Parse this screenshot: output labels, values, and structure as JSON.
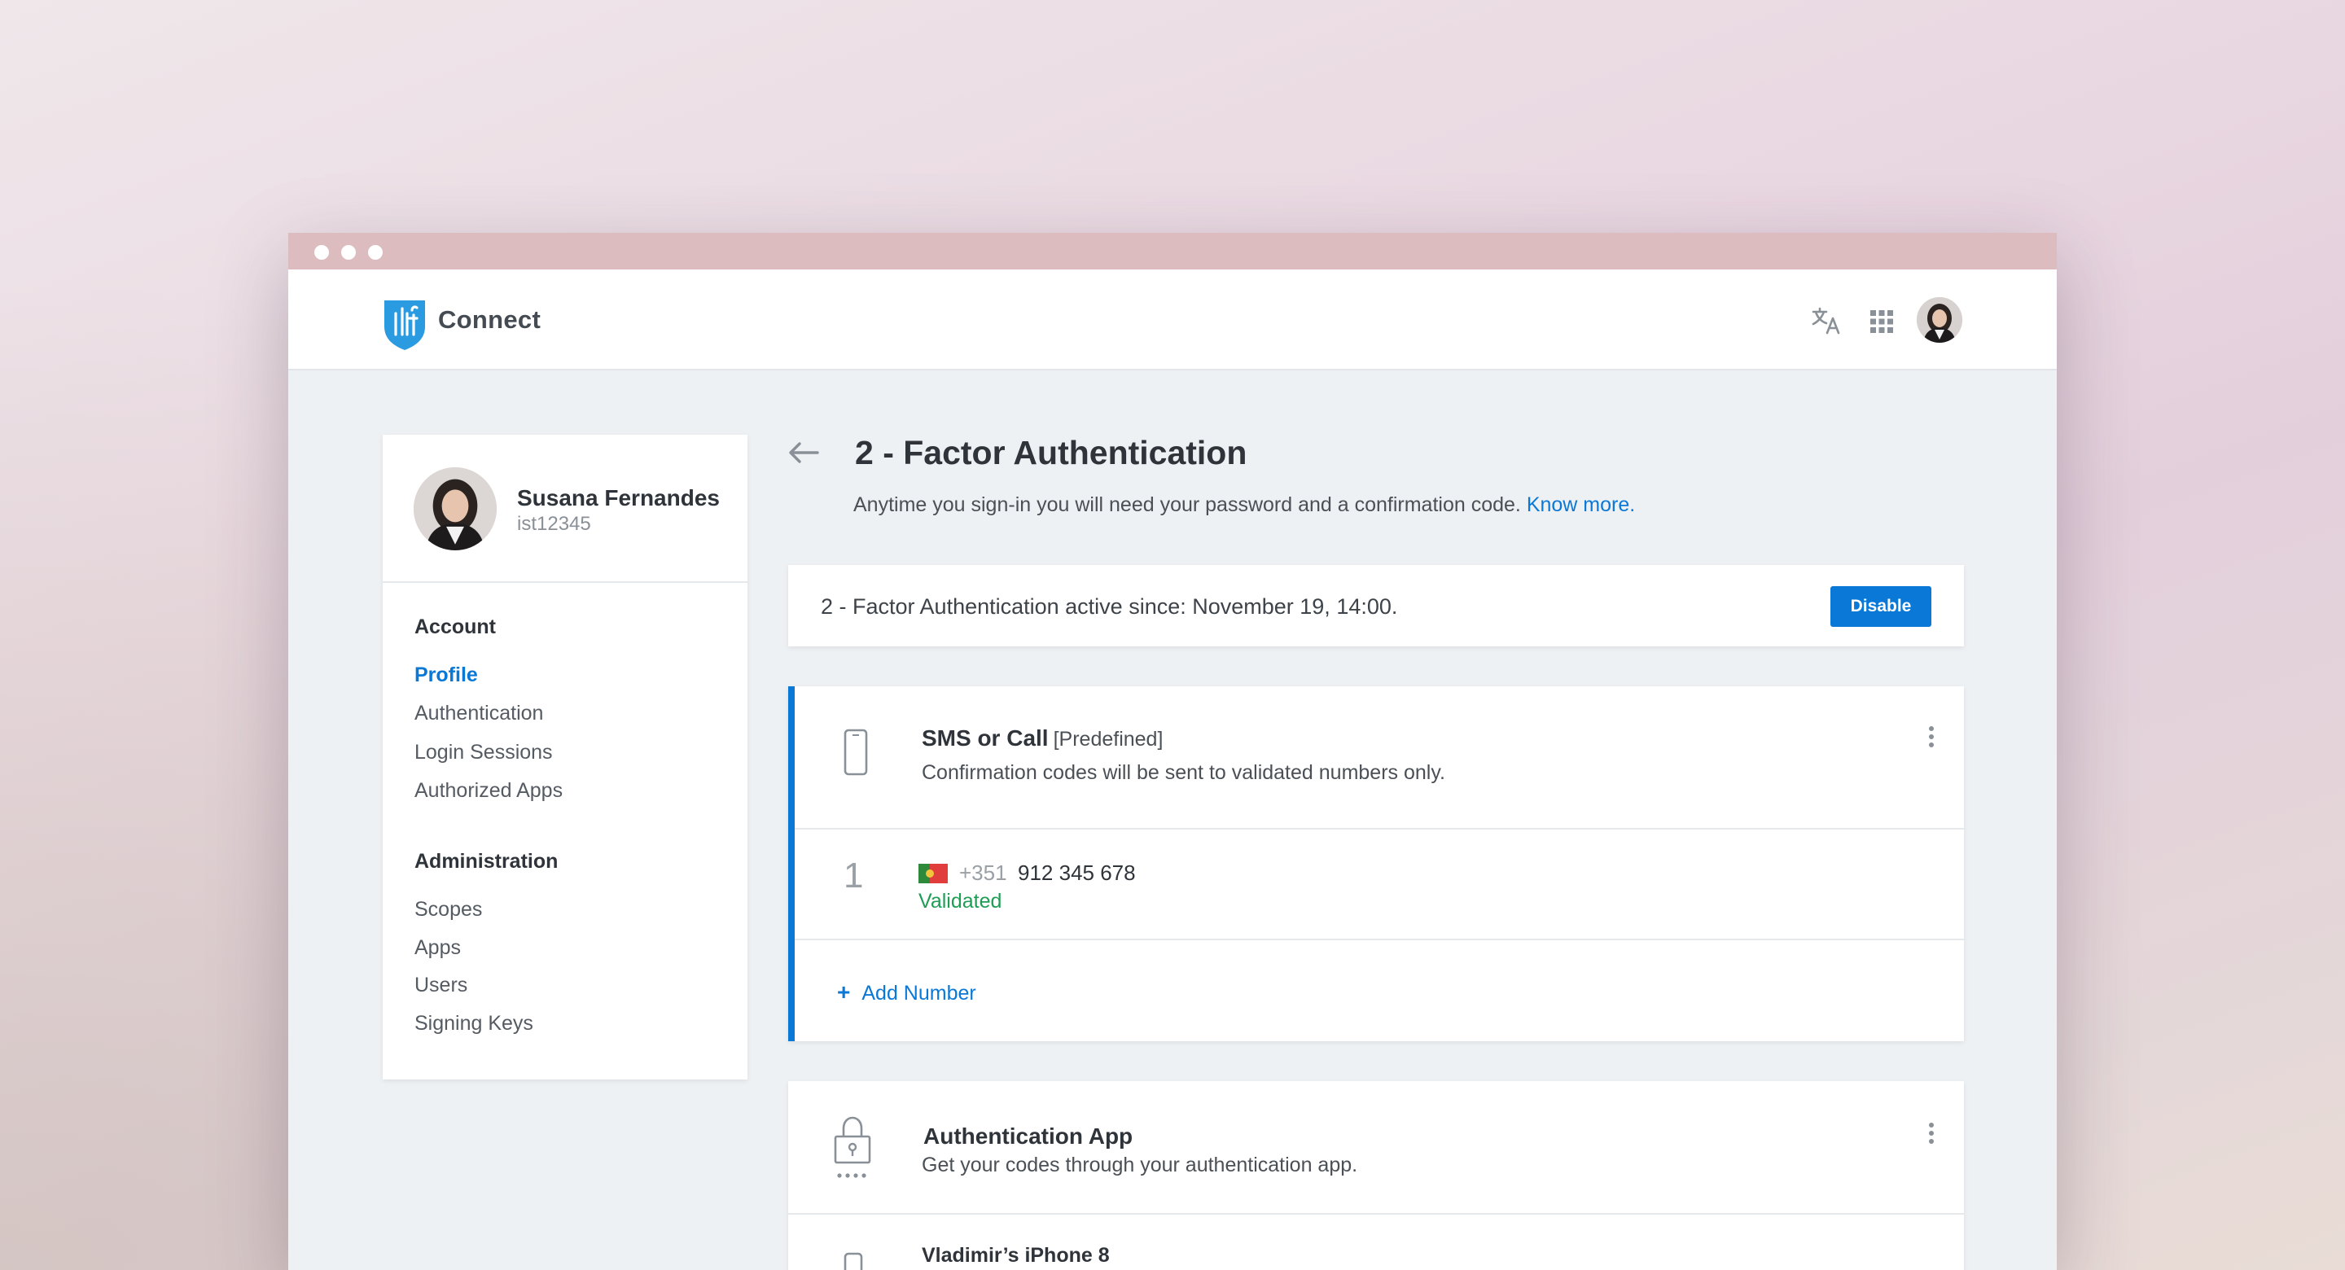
{
  "window": {
    "dots": 3
  },
  "header": {
    "brand": "Connect",
    "logo": "ist-shield-logo",
    "icons": {
      "language": "translate-icon",
      "apps": "apps-grid-icon",
      "profile": "avatar"
    }
  },
  "sidebar": {
    "user": {
      "name": "Susana Fernandes",
      "id": "ist12345"
    },
    "sections": [
      {
        "heading": "Account",
        "items": [
          "Profile",
          "Authentication",
          "Login Sessions",
          "Authorized Apps"
        ]
      },
      {
        "heading": "Administration",
        "items": [
          "Scopes",
          "Apps",
          "Users",
          "Signing Keys"
        ]
      }
    ],
    "active_item": "Profile"
  },
  "main": {
    "title": "2 - Factor Authentication",
    "subtitle": "Anytime you sign-in you will need your password and a confirmation code.",
    "know_more": "Know more.",
    "status": {
      "text": "2 - Factor Authentication active since: November 19, 14:00.",
      "button": "Disable"
    },
    "sms": {
      "title": "SMS or Call",
      "tag": "[Predefined]",
      "description": "Confirmation codes will be sent to validated numbers only.",
      "numbers": [
        {
          "index": "1",
          "prefix": "+351",
          "number": "912 345 678",
          "status": "Validated"
        }
      ],
      "add_label": "Add Number"
    },
    "app": {
      "title": "Authentication App",
      "description": "Get your codes through your authentication app.",
      "device": "Vladimir’s iPhone 8"
    }
  },
  "colors": {
    "accent": "#0a78d6",
    "success": "#1f9d55",
    "titlebar": "#dcbcbf"
  }
}
